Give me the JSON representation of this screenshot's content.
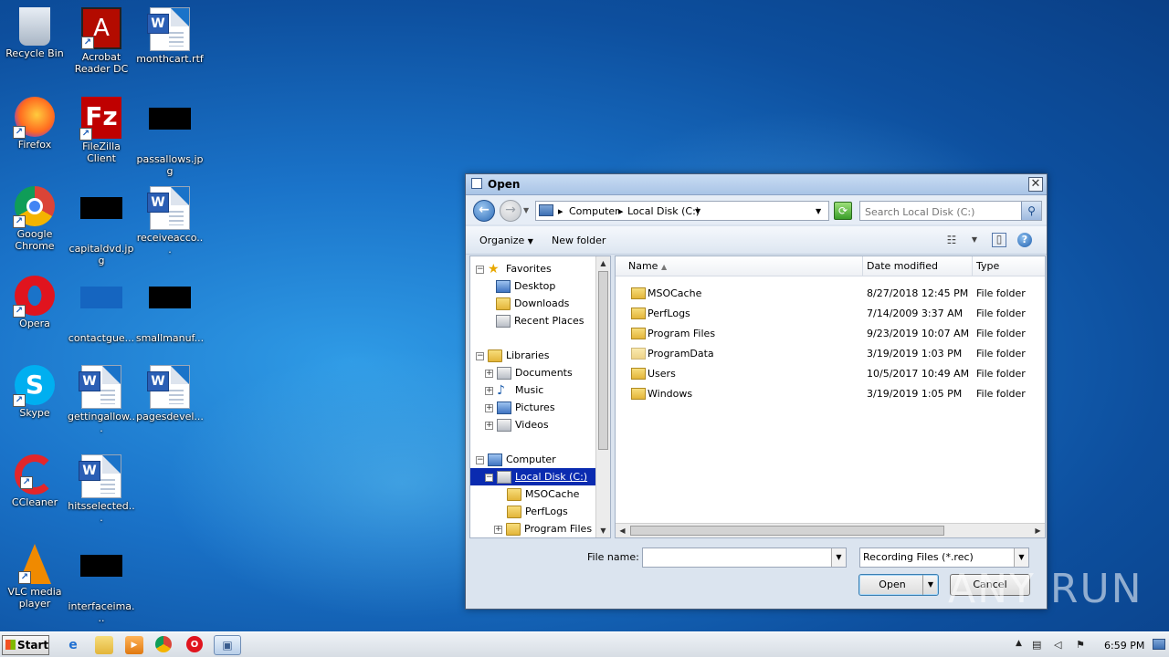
{
  "desktop": {
    "icons": [
      {
        "label": "Recycle Bin",
        "icon": "recycle-bin-icon"
      },
      {
        "label": "Acrobat Reader DC",
        "icon": "acrobat-icon"
      },
      {
        "label": "monthcart.rtf",
        "icon": "word-doc-icon"
      },
      {
        "label": "Firefox",
        "icon": "firefox-icon"
      },
      {
        "label": "FileZilla Client",
        "icon": "filezilla-icon"
      },
      {
        "label": "passallows.jpg",
        "icon": "image-thumb-icon"
      },
      {
        "label": "Google Chrome",
        "icon": "chrome-icon"
      },
      {
        "label": "capitaldvd.jpg",
        "icon": "image-thumb-icon"
      },
      {
        "label": "receiveacco...",
        "icon": "word-doc-icon"
      },
      {
        "label": "Opera",
        "icon": "opera-icon"
      },
      {
        "label": "contactgue...",
        "icon": "image-thumb-icon"
      },
      {
        "label": "smallmanuf...",
        "icon": "image-thumb-icon"
      },
      {
        "label": "Skype",
        "icon": "skype-icon"
      },
      {
        "label": "gettingallow...",
        "icon": "word-doc-icon"
      },
      {
        "label": "pagesdevel...",
        "icon": "word-doc-icon"
      },
      {
        "label": "CCleaner",
        "icon": "ccleaner-icon"
      },
      {
        "label": "hitsselected...",
        "icon": "word-doc-icon"
      },
      {
        "label": "VLC media player",
        "icon": "vlc-icon"
      },
      {
        "label": "interfaceima...",
        "icon": "image-thumb-icon"
      }
    ]
  },
  "dialog": {
    "title": "Open",
    "close_glyph": "✕",
    "address": {
      "root": "Computer",
      "current": "Local Disk (C:)"
    },
    "search_placeholder": "Search Local Disk (C:)",
    "toolbar": {
      "organize": "Organize",
      "new_folder": "New folder"
    },
    "nav": {
      "favorites": "Favorites",
      "desktop": "Desktop",
      "downloads": "Downloads",
      "recent": "Recent Places",
      "libraries": "Libraries",
      "documents": "Documents",
      "music": "Music",
      "pictures": "Pictures",
      "videos": "Videos",
      "computer": "Computer",
      "local_disk": "Local Disk (C:)",
      "msocache": "MSOCache",
      "perflogs": "PerfLogs",
      "program_files": "Program Files"
    },
    "columns": {
      "name": "Name",
      "date": "Date modified",
      "type": "Type"
    },
    "files": [
      {
        "name": "MSOCache",
        "date": "8/27/2018 12:45 PM",
        "type": "File folder"
      },
      {
        "name": "PerfLogs",
        "date": "7/14/2009 3:37 AM",
        "type": "File folder"
      },
      {
        "name": "Program Files",
        "date": "9/23/2019 10:07 AM",
        "type": "File folder"
      },
      {
        "name": "ProgramData",
        "date": "3/19/2019 1:03 PM",
        "type": "File folder"
      },
      {
        "name": "Users",
        "date": "10/5/2017 10:49 AM",
        "type": "File folder"
      },
      {
        "name": "Windows",
        "date": "3/19/2019 1:05 PM",
        "type": "File folder"
      }
    ],
    "footer": {
      "file_name_label": "File name:",
      "file_name_value": "",
      "filter": "Recording Files (*.rec)",
      "open": "Open",
      "cancel": "Cancel"
    }
  },
  "taskbar": {
    "start": "Start",
    "clock": "6:59 PM"
  },
  "watermark": "ANY RUN"
}
